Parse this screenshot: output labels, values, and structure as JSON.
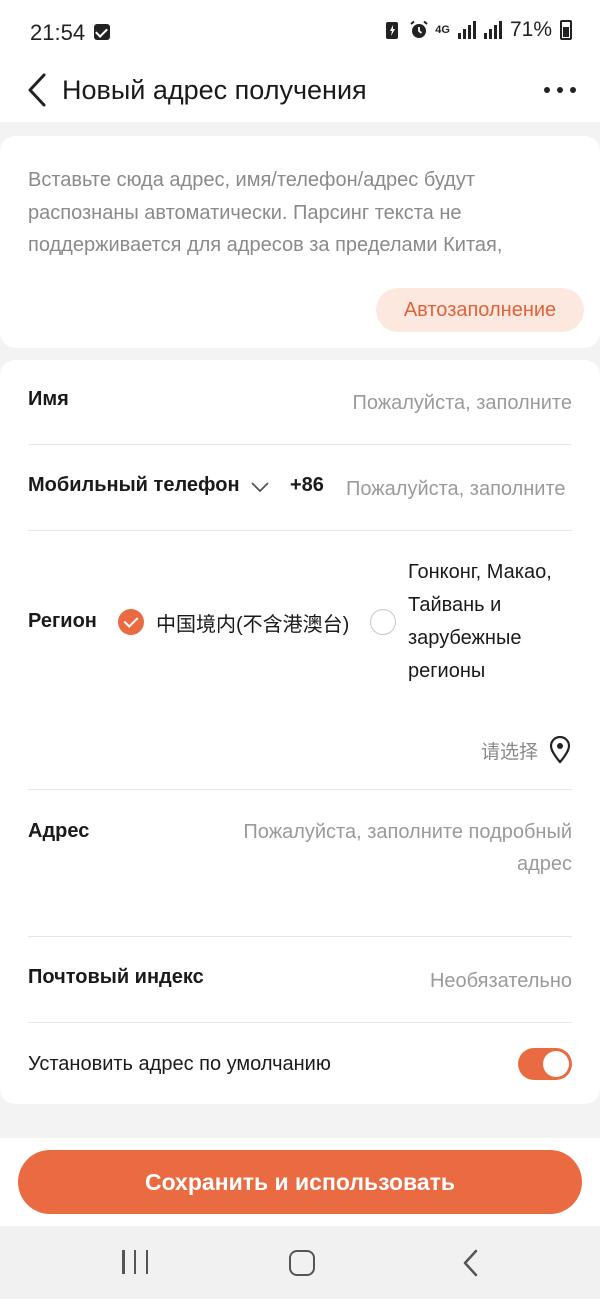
{
  "status_bar": {
    "time": "21:54",
    "network": "4G",
    "battery": "71%"
  },
  "header": {
    "title": "Новый адрес получения"
  },
  "paste_area": {
    "placeholder": "Вставьте сюда адрес, имя/телефон/адрес будут распознаны автоматически. Парсинг текста не поддерживается для адресов за пределами Китая,",
    "autofill_label": "Автозаполнение"
  },
  "form": {
    "name": {
      "label": "Имя",
      "placeholder": "Пожалуйста, заполните"
    },
    "phone": {
      "label": "Мобильный телефон",
      "country_code": "+86",
      "placeholder": "Пожалуйста, заполните"
    },
    "region": {
      "label": "Регион",
      "option_mainland": "中国境内(不含港澳台)",
      "option_mainland_selected": true,
      "option_abroad": "Гонконг, Макао, Тайвань и зарубежные регионы",
      "option_abroad_selected": false,
      "select_placeholder": "请选择"
    },
    "address": {
      "label": "Адрес",
      "placeholder": "Пожалуйста, заполните подробный адрес"
    },
    "postal_code": {
      "label": "Почтовый индекс",
      "placeholder": "Необязательно"
    },
    "default_address": {
      "label": "Установить адрес по умолчанию",
      "enabled": true
    }
  },
  "actions": {
    "save_label": "Сохранить и использовать"
  },
  "colors": {
    "accent": "#ea6a42",
    "autofill_bg": "#fde8e0",
    "page_bg": "#f3f3f3"
  },
  "icons": [
    "back-arrow-icon",
    "more-icon",
    "chevron-down-icon",
    "check-icon",
    "location-pin-icon",
    "recent-apps-icon",
    "home-icon",
    "system-back-icon"
  ]
}
